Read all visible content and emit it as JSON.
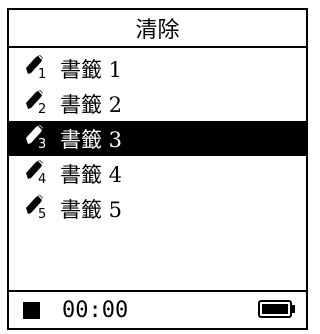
{
  "header": {
    "title": "清除"
  },
  "bookmarks": [
    {
      "label": "書籤 1",
      "icon": "bookmark-pen-icon",
      "index": "1",
      "selected": false
    },
    {
      "label": "書籤 2",
      "icon": "bookmark-pen-icon",
      "index": "2",
      "selected": false
    },
    {
      "label": "書籤 3",
      "icon": "bookmark-pen-icon",
      "index": "3",
      "selected": true
    },
    {
      "label": "書籤 4",
      "icon": "bookmark-pen-icon",
      "index": "4",
      "selected": false
    },
    {
      "label": "書籤 5",
      "icon": "bookmark-pen-icon",
      "index": "5",
      "selected": false
    }
  ],
  "status": {
    "state_icon": "stop-icon",
    "time": "00:00",
    "battery_icon": "battery-full-icon",
    "battery_level": 1.0
  },
  "colors": {
    "background": "#ffffff",
    "foreground": "#000000",
    "selection": "#000000"
  }
}
